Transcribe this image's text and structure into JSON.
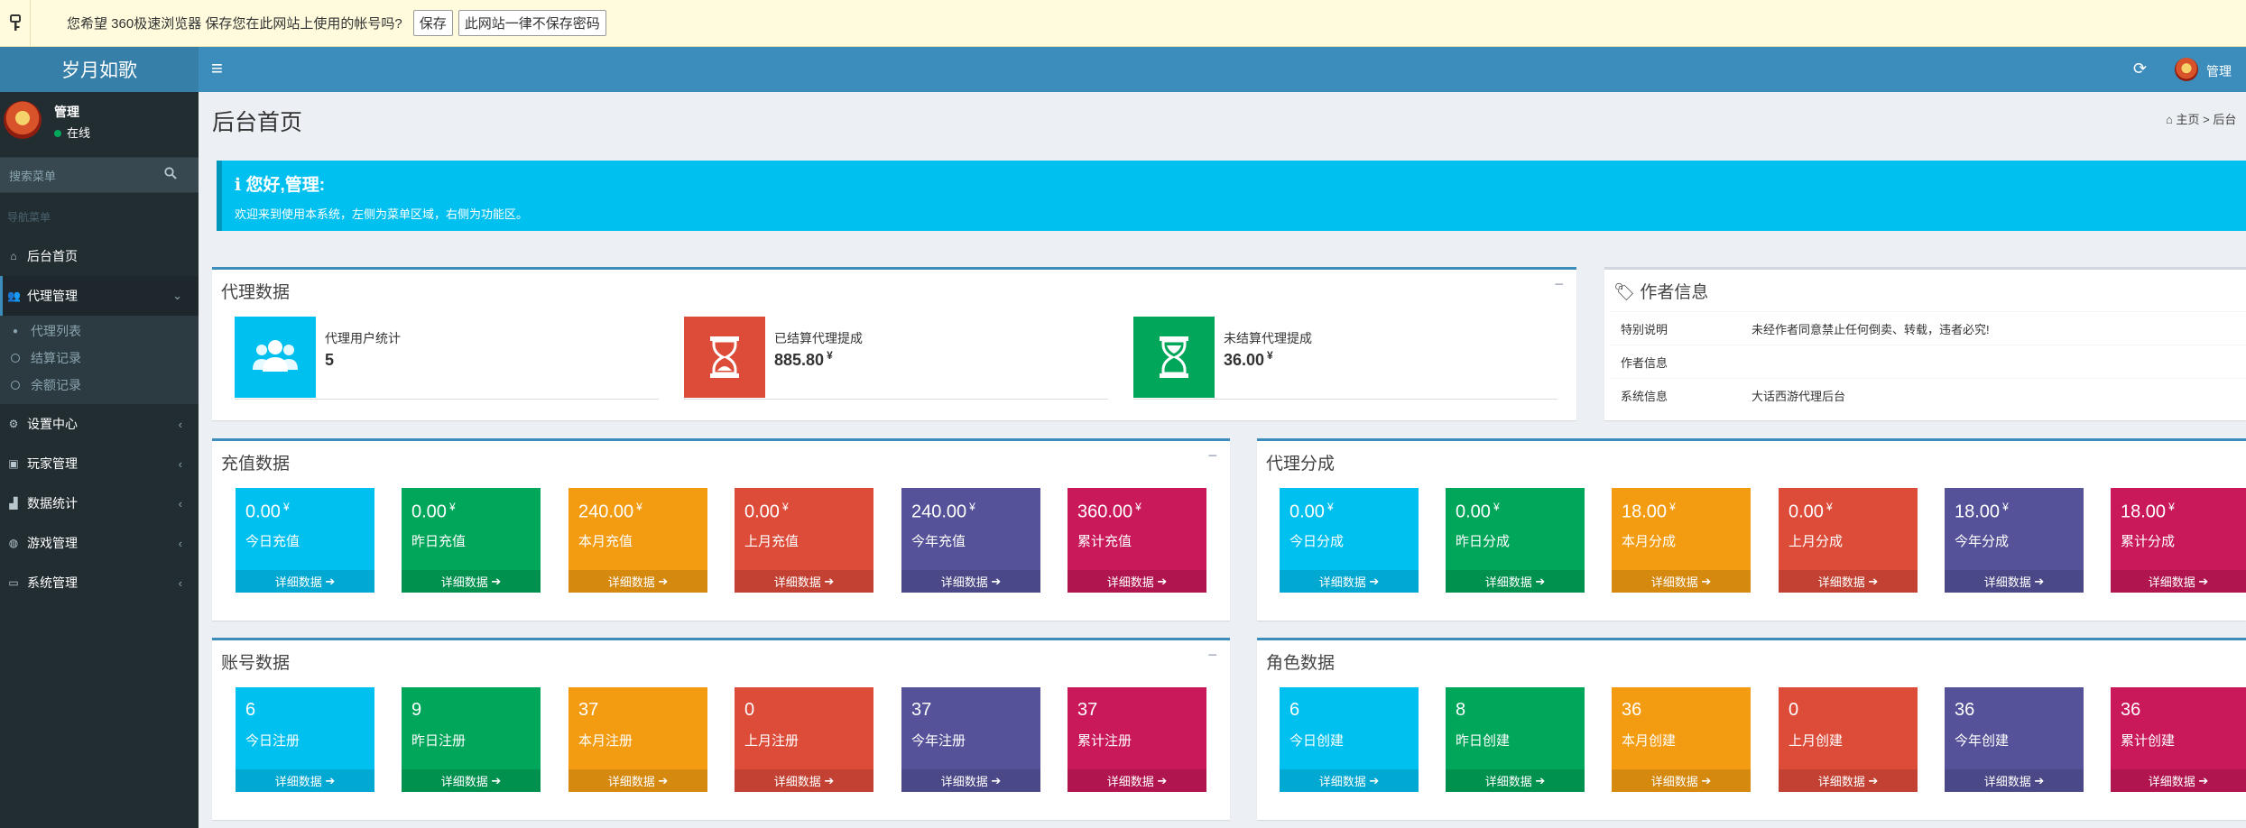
{
  "password_bar": {
    "message": "您希望 360极速浏览器 保存您在此网站上使用的帐号吗?",
    "save_label": "保存",
    "never_label": "此网站一律不保存密码"
  },
  "header": {
    "logo_text": "岁月如歌",
    "toggle_icon": "≡",
    "refresh_icon": "⟳",
    "user_name": "管理"
  },
  "sidebar": {
    "user_name": "管理",
    "status": "在线",
    "search_placeholder": "搜索菜单",
    "nav_header": "导航菜单",
    "items": [
      {
        "label": "后台首页",
        "icon": "home-icon"
      },
      {
        "label": "代理管理",
        "icon": "users-icon"
      },
      {
        "label": "设置中心",
        "icon": "cogs-icon"
      },
      {
        "label": "玩家管理",
        "icon": "address-card-icon"
      },
      {
        "label": "数据统计",
        "icon": "area-chart-icon"
      },
      {
        "label": "游戏管理",
        "icon": "gamepad-icon"
      },
      {
        "label": "系统管理",
        "icon": "desktop-icon"
      }
    ],
    "subitems": [
      "代理列表",
      "结算记录",
      "余额记录"
    ]
  },
  "page": {
    "title": "后台首页",
    "breadcrumb_home": "主页",
    "breadcrumb_current": "后台"
  },
  "callout": {
    "heading": "您好,管理:",
    "text": "欢迎来到使用本系统，左侧为菜单区域，右侧为功能区。"
  },
  "agent_box": {
    "title": "代理数据",
    "collapse": "−",
    "items": [
      {
        "label": "代理用户统计",
        "value": "5",
        "unit": "",
        "color": "#00c0ef",
        "icon": "users-icon"
      },
      {
        "label": "已结算代理提成",
        "value": "885.80",
        "unit": "¥",
        "color": "#dd4b39",
        "icon": "hourglass-icon"
      },
      {
        "label": "未结算代理提成",
        "value": "36.00",
        "unit": "¥",
        "color": "#00a65a",
        "icon": "hourglass-icon"
      }
    ]
  },
  "author_box": {
    "title": "作者信息",
    "rows": [
      {
        "key": "特别说明",
        "value": "未经作者同意禁止任何倒卖、转载，违者必究!"
      },
      {
        "key": "作者信息",
        "value": ""
      },
      {
        "key": "系统信息",
        "value": "大话西游代理后台"
      }
    ]
  },
  "recharge_box": {
    "title": "充值数据",
    "collapse": "−",
    "cards": [
      {
        "value": "0.00",
        "unit": "¥",
        "label": "今日充值",
        "footer": "详细数据"
      },
      {
        "value": "0.00",
        "unit": "¥",
        "label": "昨日充值",
        "footer": "详细数据"
      },
      {
        "value": "240.00",
        "unit": "¥",
        "label": "本月充值",
        "footer": "详细数据"
      },
      {
        "value": "0.00",
        "unit": "¥",
        "label": "上月充值",
        "footer": "详细数据"
      },
      {
        "value": "240.00",
        "unit": "¥",
        "label": "今年充值",
        "footer": "详细数据"
      },
      {
        "value": "360.00",
        "unit": "¥",
        "label": "累计充值",
        "footer": "详细数据"
      }
    ]
  },
  "share_box": {
    "title": "代理分成",
    "cards": [
      {
        "value": "0.00",
        "unit": "¥",
        "label": "今日分成",
        "footer": "详细数据"
      },
      {
        "value": "0.00",
        "unit": "¥",
        "label": "昨日分成",
        "footer": "详细数据"
      },
      {
        "value": "18.00",
        "unit": "¥",
        "label": "本月分成",
        "footer": "详细数据"
      },
      {
        "value": "0.00",
        "unit": "¥",
        "label": "上月分成",
        "footer": "详细数据"
      },
      {
        "value": "18.00",
        "unit": "¥",
        "label": "今年分成",
        "footer": "详细数据"
      },
      {
        "value": "18.00",
        "unit": "¥",
        "label": "累计分成",
        "footer": "详细数据"
      }
    ]
  },
  "account_box": {
    "title": "账号数据",
    "collapse": "−",
    "cards": [
      {
        "value": "6",
        "label": "今日注册",
        "footer": "详细数据"
      },
      {
        "value": "9",
        "label": "昨日注册",
        "footer": "详细数据"
      },
      {
        "value": "37",
        "label": "本月注册",
        "footer": "详细数据"
      },
      {
        "value": "0",
        "label": "上月注册",
        "footer": "详细数据"
      },
      {
        "value": "37",
        "label": "今年注册",
        "footer": "详细数据"
      },
      {
        "value": "37",
        "label": "累计注册",
        "footer": "详细数据"
      }
    ]
  },
  "role_box": {
    "title": "角色数据",
    "cards": [
      {
        "value": "6",
        "label": "今日创建",
        "footer": "详细数据"
      },
      {
        "value": "8",
        "label": "昨日创建",
        "footer": "详细数据"
      },
      {
        "value": "36",
        "label": "本月创建",
        "footer": "详细数据"
      },
      {
        "value": "0",
        "label": "上月创建",
        "footer": "详细数据"
      },
      {
        "value": "36",
        "label": "今年创建",
        "footer": "详细数据"
      },
      {
        "value": "36",
        "label": "累计创建",
        "footer": "详细数据"
      }
    ]
  },
  "colors": {
    "aqua": "#00c0ef",
    "green": "#00a65a",
    "yellow": "#f39c12",
    "red": "#dd4b39",
    "purple": "#555299",
    "maroon": "#ca195a",
    "header": "#3c8dbc",
    "sidebar": "#222d32"
  }
}
